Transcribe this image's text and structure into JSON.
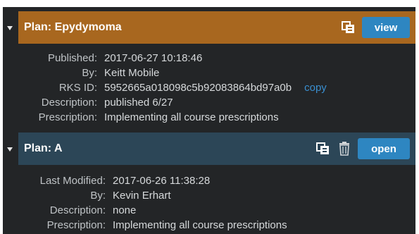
{
  "plans": [
    {
      "title": "Plan: Epydymoma",
      "action_label": "view",
      "fields": [
        {
          "label": "Published:",
          "value": "2017-06-27 10:18:46"
        },
        {
          "label": "By:",
          "value": "Keitt Mobile"
        },
        {
          "label": "RKS ID:",
          "value": "5952665a018098c5b92083864bd97a0b"
        },
        {
          "label": "Description:",
          "value": "published 6/27"
        },
        {
          "label": "Prescription:",
          "value": "Implementing all course prescriptions"
        }
      ],
      "copy_label": "copy"
    },
    {
      "title": "Plan: A",
      "action_label": "open",
      "fields": [
        {
          "label": "Last Modified:",
          "value": "2017-06-26 11:38:28"
        },
        {
          "label": "By:",
          "value": "Kevin Erhart"
        },
        {
          "label": "Description:",
          "value": "none"
        },
        {
          "label": "Prescription:",
          "value": "Implementing all course prescriptions"
        }
      ]
    }
  ],
  "colors": {
    "published_header": "#a8671f",
    "draft_header": "#2c4657",
    "button": "#2e86c1",
    "panel": "#232527"
  },
  "icons": {
    "duplicate": "duplicate-icon",
    "trash": "trash-icon",
    "collapse": "caret-down-icon"
  }
}
